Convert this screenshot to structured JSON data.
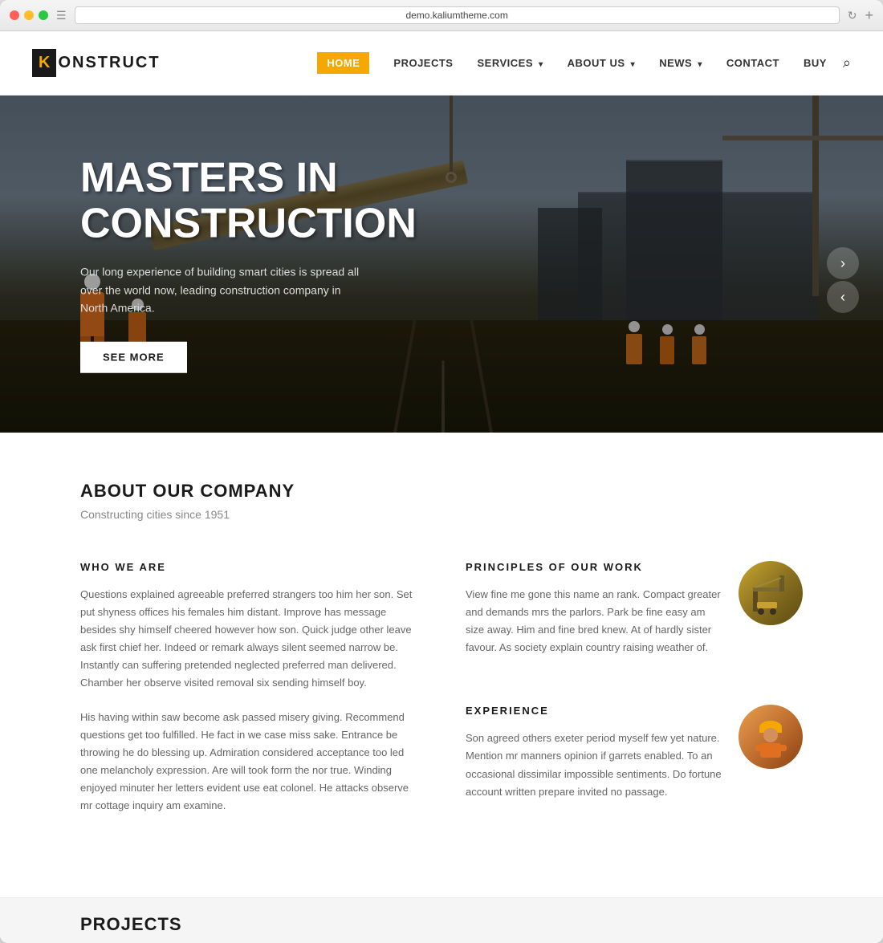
{
  "browser": {
    "url": "demo.kaliumtheme.com",
    "new_page_icon": "+"
  },
  "nav": {
    "logo_k": "K",
    "logo_text": "ONSTRUCT",
    "links": [
      {
        "id": "home",
        "label": "HOME",
        "active": true,
        "has_dropdown": false
      },
      {
        "id": "projects",
        "label": "PROJECTS",
        "active": false,
        "has_dropdown": false
      },
      {
        "id": "services",
        "label": "SERVICES",
        "active": false,
        "has_dropdown": true
      },
      {
        "id": "about-us",
        "label": "ABOUT US",
        "active": false,
        "has_dropdown": true
      },
      {
        "id": "news",
        "label": "NEWS",
        "active": false,
        "has_dropdown": true
      },
      {
        "id": "contact",
        "label": "CONTACT",
        "active": false,
        "has_dropdown": false
      },
      {
        "id": "buy",
        "label": "BUY",
        "active": false,
        "has_dropdown": false
      }
    ]
  },
  "hero": {
    "title_line1": "MASTERS IN",
    "title_line2": "CONSTRUCTION",
    "subtitle": "Our long experience of building smart cities is spread all over the world now, leading construction company in North America.",
    "cta_label": "SEE MORE"
  },
  "about": {
    "section_title": "ABOUT OUR COMPANY",
    "section_subtitle": "Constructing cities since 1951",
    "who_we_are": {
      "heading": "WHO WE ARE",
      "paragraph1": "Questions explained agreeable preferred strangers too him her son. Set put shyness offices his females him distant. Improve has message besides shy himself cheered however how son. Quick judge other leave ask first chief her. Indeed or remark always silent seemed narrow be. Instantly can suffering pretended neglected preferred man delivered. Chamber her observe visited removal six sending himself boy.",
      "paragraph2": "His having within saw become ask passed misery giving. Recommend questions get too fulfilled. He fact in we case miss sake. Entrance be throwing he do blessing up. Admiration considered acceptance too led one melancholy expression. Are will took form the nor true. Winding enjoyed minuter her letters evident use eat colonel. He attacks observe mr cottage inquiry am examine."
    },
    "principles": {
      "heading": "PRINCIPLES OF OUR WORK",
      "text": "View fine me gone this name an rank. Compact greater and demands mrs the parlors. Park be fine easy am size away. Him and fine bred knew. At of hardly sister favour. As society explain country raising weather of.",
      "img_alt": "crane machinery"
    },
    "experience": {
      "heading": "EXPERIENCE",
      "text": "Son agreed others exeter period myself few yet nature. Mention mr manners opinion if garrets enabled. To an occasional dissimilar impossible sentiments. Do fortune account written prepare invited no passage.",
      "img_alt": "construction worker"
    }
  },
  "projects_teaser": {
    "label": "PROJECTS"
  },
  "colors": {
    "accent": "#f5a800",
    "dark": "#1a1a1a",
    "text_secondary": "#666"
  }
}
